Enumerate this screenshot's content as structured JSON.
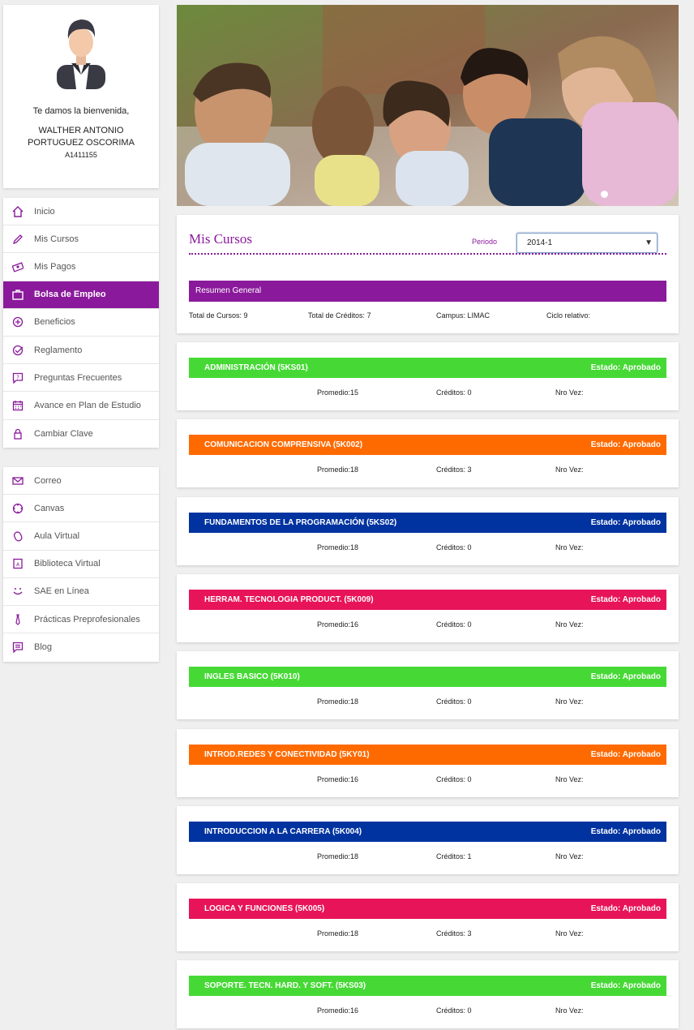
{
  "profile": {
    "welcome": "Te damos la bienvenida,",
    "name": "WALTHER ANTONIO PORTUGUEZ OSCORIMA",
    "code": "A1411155"
  },
  "menu_main": [
    {
      "label": "Inicio",
      "icon": "home-icon"
    },
    {
      "label": "Mis Cursos",
      "icon": "pencil-icon"
    },
    {
      "label": "Mis Pagos",
      "icon": "money-icon"
    },
    {
      "label": "Bolsa de Empleo",
      "icon": "briefcase-icon",
      "active": true
    },
    {
      "label": "Beneficios",
      "icon": "plus-circle-icon"
    },
    {
      "label": "Reglamento",
      "icon": "check-circle-icon"
    },
    {
      "label": "Preguntas Frecuentes",
      "icon": "question-chat-icon"
    },
    {
      "label": "Avance en Plan de Estudio",
      "icon": "calendar-icon"
    },
    {
      "label": "Cambiar Clave",
      "icon": "lock-icon"
    }
  ],
  "menu_links": [
    {
      "label": "Correo",
      "icon": "mail-icon"
    },
    {
      "label": "Canvas",
      "icon": "canvas-icon"
    },
    {
      "label": "Aula Virtual",
      "icon": "mouse-icon"
    },
    {
      "label": "Biblioteca Virtual",
      "icon": "book-icon"
    },
    {
      "label": "SAE en Línea",
      "icon": "smile-icon"
    },
    {
      "label": "Prácticas Preprofesionales",
      "icon": "tie-icon"
    },
    {
      "label": "Blog",
      "icon": "blog-icon"
    }
  ],
  "mis_cursos": {
    "title": "Mis Cursos",
    "periodo_label": "Periodo",
    "periodo_value": "2014-1",
    "resumen_title": "Resumen General",
    "total_cursos_label": "Total de Cursos:",
    "total_cursos": "9",
    "total_creditos_label": "Total de Créditos:",
    "total_creditos": "7",
    "campus_label": "Campus:",
    "campus": "LIMAC",
    "ciclo_label": "Ciclo relativo:"
  },
  "labels": {
    "promedio": "Promedio:",
    "creditos": "Créditos:",
    "nro_vez": "Nro Vez:"
  },
  "colors": {
    "purple": "#8a1a9b",
    "green": "#46d935",
    "orange": "#ff6a00",
    "blue": "#0033a0",
    "pink": "#e8145a"
  },
  "courses": [
    {
      "name": "ADMINISTRACIÓN (5KS01)",
      "estado": "Estado: Aprobado",
      "promedio": "15",
      "creditos": "0",
      "color": "#46d935"
    },
    {
      "name": "COMUNICACION COMPRENSIVA (5K002)",
      "estado": "Estado: Aprobado",
      "promedio": "18",
      "creditos": "3",
      "color": "#ff6a00"
    },
    {
      "name": "FUNDAMENTOS DE LA PROGRAMACIÓN (5KS02)",
      "estado": "Estado: Aprobado",
      "promedio": "18",
      "creditos": "0",
      "color": "#0033a0"
    },
    {
      "name": "HERRAM. TECNOLOGIA PRODUCT. (5K009)",
      "estado": "Estado: Aprobado",
      "promedio": "16",
      "creditos": "0",
      "color": "#e8145a"
    },
    {
      "name": "INGLES BASICO (5K010)",
      "estado": "Estado: Aprobado",
      "promedio": "18",
      "creditos": "0",
      "color": "#46d935"
    },
    {
      "name": "INTROD.REDES Y CONECTIVIDAD (5KY01)",
      "estado": "Estado: Aprobado",
      "promedio": "16",
      "creditos": "0",
      "color": "#ff6a00"
    },
    {
      "name": "INTRODUCCION A LA CARRERA (5K004)",
      "estado": "Estado: Aprobado",
      "promedio": "18",
      "creditos": "1",
      "color": "#0033a0"
    },
    {
      "name": "LOGICA Y FUNCIONES (5K005)",
      "estado": "Estado: Aprobado",
      "promedio": "18",
      "creditos": "3",
      "color": "#e8145a"
    },
    {
      "name": "SOPORTE. TECN. HARD. Y SOFT. (5KS03)",
      "estado": "Estado: Aprobado",
      "promedio": "16",
      "creditos": "0",
      "color": "#46d935"
    }
  ]
}
